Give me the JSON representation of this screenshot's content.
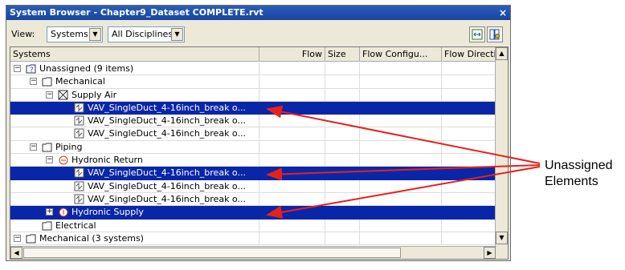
{
  "window": {
    "title": "System Browser - Chapter9_Dataset COMPLETE.rvt",
    "close_glyph": "×"
  },
  "toolbar": {
    "view_label": "View:",
    "view_select": "Systems",
    "discipline_select": "All Disciplines"
  },
  "columns": [
    "Systems",
    "Flow",
    "Size",
    "Flow Configu...",
    "Flow Directio"
  ],
  "rows": [
    {
      "level": 0,
      "toggle": "−",
      "icon": "unassigned-folder-icon",
      "label": "Unassigned (9 items)",
      "selected": false
    },
    {
      "level": 1,
      "toggle": "−",
      "icon": "folder-icon",
      "label": "Mechanical",
      "selected": false
    },
    {
      "level": 2,
      "toggle": "−",
      "icon": "supply-air-icon",
      "label": "Supply Air",
      "selected": false
    },
    {
      "level": 3,
      "toggle": "",
      "icon": "vav-box-icon",
      "label": "VAV_SingleDuct_4-16inch_break o...",
      "selected": true
    },
    {
      "level": 3,
      "toggle": "",
      "icon": "vav-box-icon",
      "label": "VAV_SingleDuct_4-16inch_break o...",
      "selected": false
    },
    {
      "level": 3,
      "toggle": "",
      "icon": "vav-box-icon",
      "label": "VAV_SingleDuct_4-16inch_break o...",
      "selected": false
    },
    {
      "level": 1,
      "toggle": "−",
      "icon": "folder-icon",
      "label": "Piping",
      "selected": false
    },
    {
      "level": 2,
      "toggle": "−",
      "icon": "hydronic-return-icon",
      "label": "Hydronic Return",
      "selected": false
    },
    {
      "level": 3,
      "toggle": "",
      "icon": "vav-box-icon",
      "label": "VAV_SingleDuct_4-16inch_break o...",
      "selected": true
    },
    {
      "level": 3,
      "toggle": "",
      "icon": "vav-box-icon",
      "label": "VAV_SingleDuct_4-16inch_break o...",
      "selected": false
    },
    {
      "level": 3,
      "toggle": "",
      "icon": "vav-box-icon",
      "label": "VAV_SingleDuct_4-16inch_break o...",
      "selected": false
    },
    {
      "level": 2,
      "toggle": "+",
      "icon": "hydronic-supply-icon",
      "label": "Hydronic Supply",
      "selected": true
    },
    {
      "level": 1,
      "toggle": "",
      "icon": "folder-icon",
      "label": "Electrical",
      "selected": false
    },
    {
      "level": 0,
      "toggle": "−",
      "icon": "folder-icon",
      "label": "Mechanical (3 systems)",
      "selected": false
    }
  ],
  "callout": {
    "line1": "Unassigned",
    "line2": "Elements",
    "arrow_color": "#e8201a"
  },
  "colors": {
    "selection": "#0a26a8",
    "titlebar": "#1c4aa8"
  }
}
